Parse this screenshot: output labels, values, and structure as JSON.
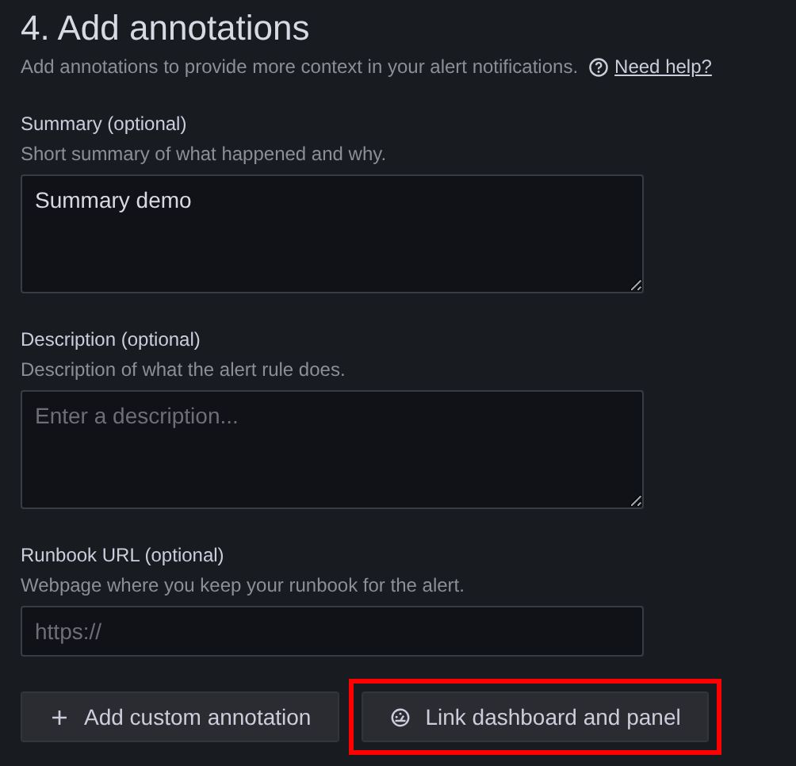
{
  "section": {
    "title": "4. Add annotations",
    "description": "Add annotations to provide more context in your alert notifications.",
    "help_link": "Need help?"
  },
  "fields": [
    {
      "kind": "textarea",
      "label": "Summary (optional)",
      "hint": "Short summary of what happened and why.",
      "value": "Summary demo"
    },
    {
      "kind": "textarea",
      "label": "Description (optional)",
      "hint": "Description of what the alert rule does.",
      "placeholder": "Enter a description..."
    },
    {
      "kind": "input",
      "label": "Runbook URL (optional)",
      "hint": "Webpage where you keep your runbook for the alert.",
      "placeholder": "https://"
    }
  ],
  "buttons": [
    {
      "kind": "add",
      "label": "Add custom annotation",
      "highlighted": false
    },
    {
      "kind": "link",
      "label": "Link dashboard and panel",
      "highlighted": true
    }
  ]
}
